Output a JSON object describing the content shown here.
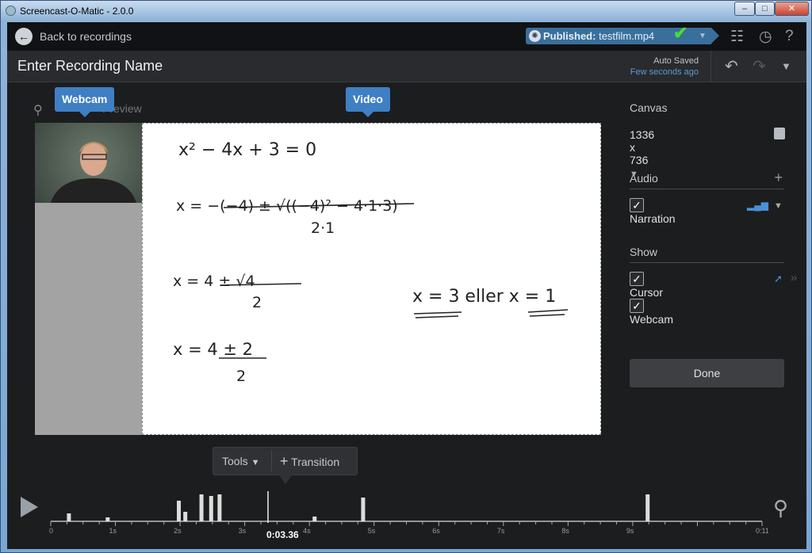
{
  "window": {
    "title": "Screencast-O-Matic - 2.0.0",
    "buttons": [
      "minimize",
      "maximize",
      "close"
    ]
  },
  "topbar": {
    "back_label": "Back to recordings",
    "published_label": "Published:",
    "published_file": "testfilm.mp4",
    "status_color": "#44dd33",
    "icons": [
      "checklist-icon",
      "history-icon",
      "help-icon"
    ]
  },
  "header": {
    "recording_name": "Enter Recording Name",
    "auto_saved": "Auto Saved",
    "saved_time": "Few seconds ago"
  },
  "stage": {
    "webcam_tip": "Webcam",
    "video_tip": "Video",
    "preview_label": "Preview"
  },
  "board": {
    "lines": [
      "x² − 4x + 3 = 0",
      "x = −(−4) ± √((−4)² − 4·1·3)",
      "2·1",
      "x = 4 ± √4",
      "2",
      "x = 4 ± 2",
      "2",
      "x = 3 eller x = 1"
    ]
  },
  "sidebar": {
    "canvas_title": "Canvas",
    "canvas_size": "1336 x 736",
    "audio_title": "Audio",
    "narration": "Narration",
    "show_title": "Show",
    "cursor": "Cursor",
    "webcam": "Webcam",
    "done": "Done"
  },
  "timeline": {
    "tools": "Tools",
    "transition": "Transition",
    "current_time": "0:03.36",
    "ticks": [
      "0",
      "1s",
      "2s",
      "3s",
      "4s",
      "5s",
      "6s",
      "7s",
      "8s",
      "9s",
      "0:11"
    ],
    "duration_s": 11,
    "playhead_s": 3.36
  }
}
